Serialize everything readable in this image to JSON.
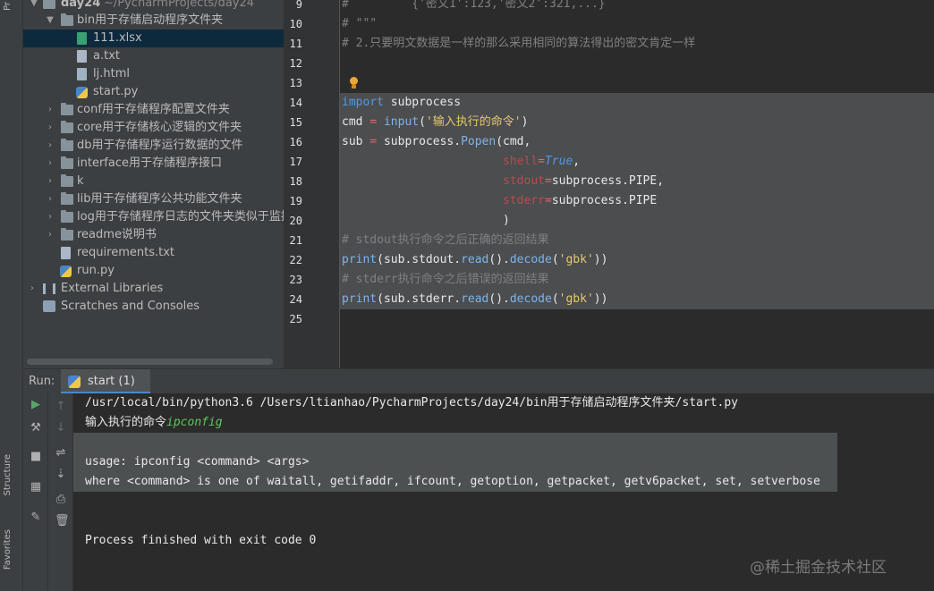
{
  "tool_strip": {
    "top_tab": "Pr",
    "structure_tab": "Structure",
    "favorites_tab": "Favorites"
  },
  "project_tree": {
    "root": {
      "label": "day24",
      "path": "~/PycharmProjects/day24"
    },
    "items": [
      {
        "label": "bin用于存储启动程序文件夹",
        "type": "folder",
        "expanded": true,
        "depth": 1
      },
      {
        "label": "111.xlsx",
        "type": "xlsx",
        "depth": 2,
        "selected": true
      },
      {
        "label": "a.txt",
        "type": "file",
        "depth": 2
      },
      {
        "label": "lj.html",
        "type": "html",
        "depth": 2
      },
      {
        "label": "start.py",
        "type": "py",
        "depth": 2
      },
      {
        "label": "conf用于存储程序配置文件夹",
        "type": "folder",
        "depth": 1
      },
      {
        "label": "core用于存储核心逻辑的文件夹",
        "type": "folder",
        "depth": 1
      },
      {
        "label": "db用于存储程序运行数据的文件",
        "type": "folder",
        "depth": 1
      },
      {
        "label": "interface用于存储程序接口",
        "type": "folder",
        "depth": 1
      },
      {
        "label": "k",
        "type": "folder",
        "depth": 1
      },
      {
        "label": "lib用于存储程序公共功能文件夹",
        "type": "folder",
        "depth": 1
      },
      {
        "label": "log用于存储程序日志的文件夹类似于监控",
        "type": "folder",
        "depth": 1
      },
      {
        "label": "readme说明书",
        "type": "folder",
        "depth": 1
      },
      {
        "label": "requirements.txt",
        "type": "file",
        "depth": 1
      },
      {
        "label": "run.py",
        "type": "py",
        "depth": 1
      },
      {
        "label": "External Libraries",
        "type": "lib",
        "depth": 0
      },
      {
        "label": "Scratches and Consoles",
        "type": "scratch",
        "depth": 0
      }
    ]
  },
  "editor": {
    "line_numbers": [
      "9",
      "10",
      "11",
      "12",
      "13",
      "14",
      "15",
      "16",
      "17",
      "18",
      "19",
      "20",
      "21",
      "22",
      "23",
      "24",
      "25"
    ],
    "lines": {
      "l9_comment": "#         {'密文1':123,'密文2':321,...}",
      "l10_comment": "# \"\"\"",
      "l11_comment": "# 2.只要明文数据是一样的那么采用相同的算法得出的密文肯定一样",
      "l14_kw": "import",
      "l14_rest": " subprocess",
      "l15_a": "cmd ",
      "l15_eq": "=",
      "l15_b": " ",
      "l15_fn": "input",
      "l15_c": "(",
      "l15_str": "'输入执行的命令'",
      "l15_d": ")",
      "l16_a": "sub ",
      "l16_eq": "=",
      "l16_b": " subprocess.",
      "l16_fn": "Popen",
      "l16_c": "(cmd,",
      "l17_indent": "                       ",
      "l17_param": "shell",
      "l17_eq": "=",
      "l17_val": "True",
      "l17_end": ",",
      "l18_indent": "                       ",
      "l18_param": "stdout",
      "l18_eq": "=",
      "l18_rest": "subprocess.PIPE,",
      "l19_indent": "                       ",
      "l19_param": "stderr",
      "l19_eq": "=",
      "l19_rest": "subprocess.PIPE",
      "l20": "                       )",
      "l21_comment": "# stdout执行命令之后正确的返回结果",
      "l22_fn": "print",
      "l22_a": "(sub.stdout.",
      "l22_fn2": "read",
      "l22_b": "().",
      "l22_fn3": "decode",
      "l22_c": "(",
      "l22_str": "'gbk'",
      "l22_d": "))",
      "l23_comment": "# stderr执行命令之后错误的返回结果",
      "l24_fn": "print",
      "l24_a": "(sub.stderr.",
      "l24_fn2": "read",
      "l24_b": "().",
      "l24_fn3": "decode",
      "l24_c": "(",
      "l24_str": "'gbk'",
      "l24_d": "))"
    }
  },
  "run_panel": {
    "label": "Run:",
    "tab_label": "start (1)",
    "output": {
      "command": "/usr/local/bin/python3.6 /Users/ltianhao/PycharmProjects/day24/bin用于存储启动程序文件夹/start.py",
      "prompt": "输入执行的命令",
      "user_input": "ipconfig",
      "usage": "usage: ipconfig <command> <args>",
      "where": "where <command> is one of waitall, getifaddr, ifcount, getoption, getpacket, getv6packet, set, setverbose",
      "finished": "Process finished with exit code 0"
    }
  },
  "watermark": "@稀土掘金技术社区"
}
